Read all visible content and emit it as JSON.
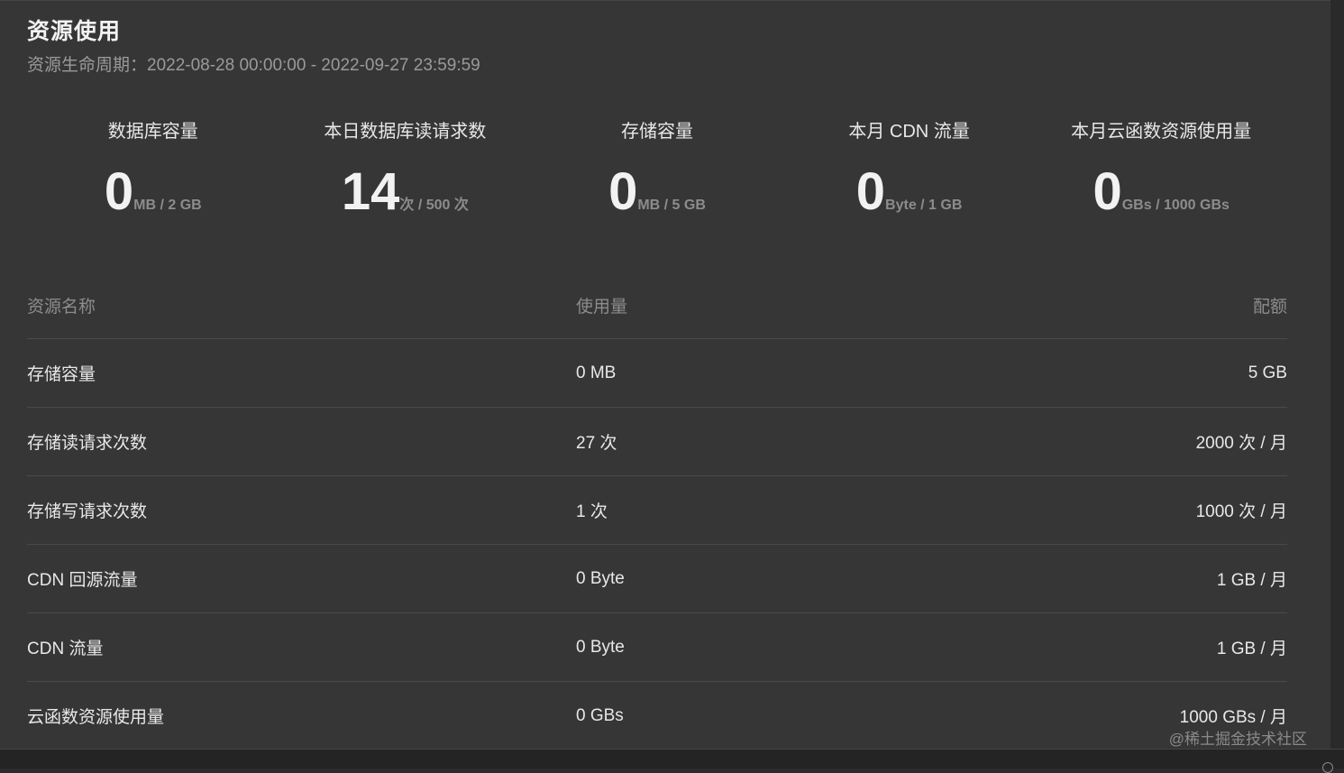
{
  "header": {
    "title": "资源使用",
    "cycle": "资源生命周期：2022-08-28 00:00:00 - 2022-09-27 23:59:59"
  },
  "stats": [
    {
      "label": "数据库容量",
      "value": "0",
      "unit": "MB / 2 GB"
    },
    {
      "label": "本日数据库读请求数",
      "value": "14",
      "unit": "次 / 500 次"
    },
    {
      "label": "存储容量",
      "value": "0",
      "unit": "MB / 5 GB"
    },
    {
      "label": "本月 CDN 流量",
      "value": "0",
      "unit": "Byte / 1 GB"
    },
    {
      "label": "本月云函数资源使用量",
      "value": "0",
      "unit": "GBs / 1000 GBs"
    }
  ],
  "table": {
    "headers": {
      "name": "资源名称",
      "usage": "使用量",
      "quota": "配额"
    },
    "rows": [
      {
        "name": "存储容量",
        "usage": "0 MB",
        "quota": "5 GB"
      },
      {
        "name": "存储读请求次数",
        "usage": "27 次",
        "quota": "2000 次 / 月"
      },
      {
        "name": "存储写请求次数",
        "usage": "1 次",
        "quota": "1000 次 / 月"
      },
      {
        "name": "CDN 回源流量",
        "usage": "0 Byte",
        "quota": "1 GB / 月"
      },
      {
        "name": "CDN 流量",
        "usage": "0 Byte",
        "quota": "1 GB / 月"
      },
      {
        "name": "云函数资源使用量",
        "usage": "0 GBs",
        "quota": "1000 GBs / 月"
      }
    ]
  },
  "watermark": "@稀土掘金技术社区"
}
